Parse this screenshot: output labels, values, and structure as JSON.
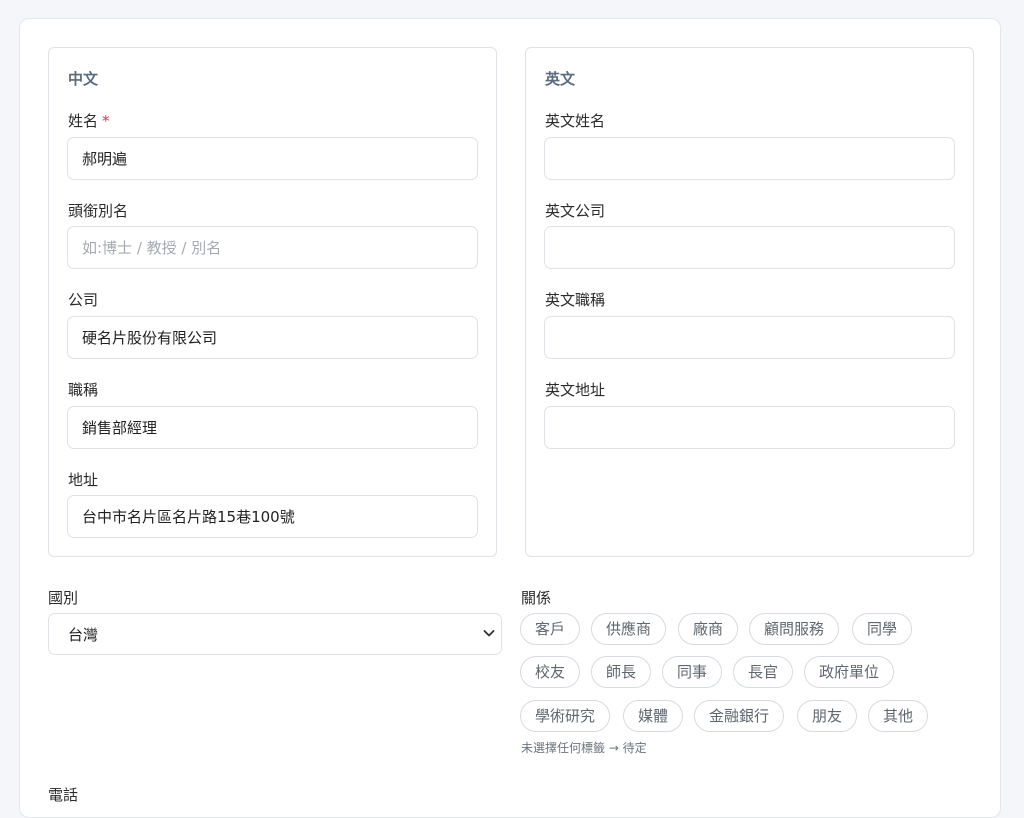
{
  "chinese": {
    "section_title": "中文",
    "name_label": "姓名",
    "required_mark": "*",
    "name_value": "郝明遍",
    "alias_label": "頭銜別名",
    "alias_placeholder": "如:博士 / 教授 / 別名",
    "company_label": "公司",
    "company_value": "硬名片股份有限公司",
    "title_label": "職稱",
    "title_value": "銷售部經理",
    "address_label": "地址",
    "address_value": "台中市名片區名片路15巷100號"
  },
  "english": {
    "section_title": "英文",
    "name_label": "英文姓名",
    "name_value": "",
    "company_label": "英文公司",
    "company_value": "",
    "title_label": "英文職稱",
    "title_value": "",
    "address_label": "英文地址",
    "address_value": ""
  },
  "country": {
    "label": "國別",
    "selected": "台灣"
  },
  "relationship": {
    "label": "關係",
    "tags": [
      "客戶",
      "供應商",
      "廠商",
      "顧問服務",
      "同學",
      "校友",
      "師長",
      "同事",
      "長官",
      "政府單位",
      "學術研究",
      "媒體",
      "金融銀行",
      "朋友",
      "其他"
    ],
    "hint": "未選擇任何標籤 → 待定"
  },
  "phone": {
    "label": "電話"
  },
  "colors": {
    "required": "#dc3545",
    "section_title": "#5b6b7e",
    "border": "#dfe2e6"
  }
}
